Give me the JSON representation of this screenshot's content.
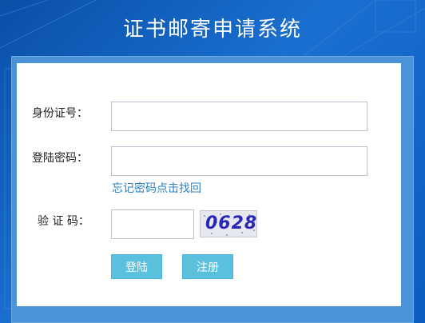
{
  "header": {
    "title": "证书邮寄申请系统"
  },
  "form": {
    "id_label": "身份证号：",
    "password_label": "登陆密码：",
    "forgot_link": "忘记密码点击找回",
    "captcha_label": "验 证 码：",
    "captcha_text": "0628",
    "id_value": "",
    "password_value": "",
    "captcha_value": ""
  },
  "buttons": {
    "login": "登陆",
    "register": "注册"
  }
}
